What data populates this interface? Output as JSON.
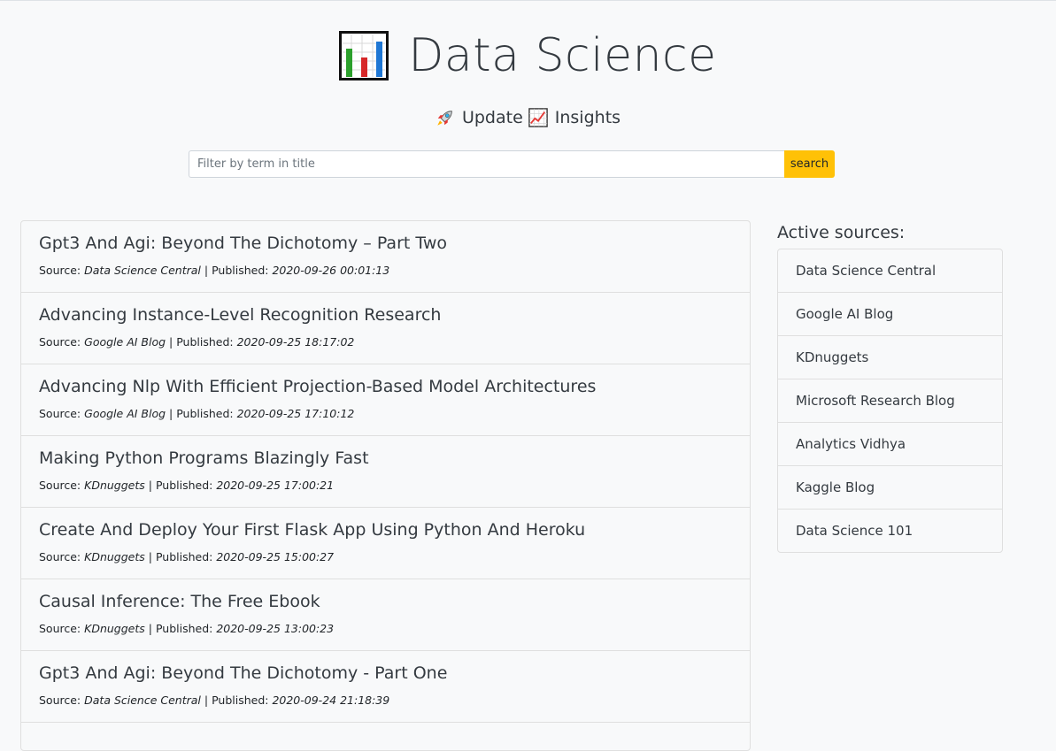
{
  "header": {
    "title": "Data Science",
    "logo_icon": "bar-chart-icon"
  },
  "nav": {
    "update_label": "Update",
    "update_icon": "rocket-icon",
    "insights_label": "Insights",
    "insights_icon": "chart-increasing-icon"
  },
  "search": {
    "placeholder": "Filter by term in title",
    "value": "",
    "button_label": "search",
    "button_color": "#ffc107"
  },
  "articles": [
    {
      "title": "Gpt3 And Agi: Beyond The Dichotomy – Part Two",
      "source_label": "Source:",
      "source": "Data Science Central",
      "published_label": "| Published:",
      "published": "2020-09-26 00:01:13"
    },
    {
      "title": "Advancing Instance-Level Recognition Research",
      "source_label": "Source:",
      "source": "Google AI Blog",
      "published_label": "| Published:",
      "published": "2020-09-25 18:17:02"
    },
    {
      "title": "Advancing Nlp With Efficient Projection-Based Model Architectures",
      "source_label": "Source:",
      "source": "Google AI Blog",
      "published_label": "| Published:",
      "published": "2020-09-25 17:10:12"
    },
    {
      "title": "Making Python Programs Blazingly Fast",
      "source_label": "Source:",
      "source": "KDnuggets",
      "published_label": "| Published:",
      "published": "2020-09-25 17:00:21"
    },
    {
      "title": "Create And Deploy Your First Flask App Using Python And Heroku",
      "source_label": "Source:",
      "source": "KDnuggets",
      "published_label": "| Published:",
      "published": "2020-09-25 15:00:27"
    },
    {
      "title": "Causal Inference: The Free Ebook",
      "source_label": "Source:",
      "source": "KDnuggets",
      "published_label": "| Published:",
      "published": "2020-09-25 13:00:23"
    },
    {
      "title": "Gpt3 And Agi: Beyond The Dichotomy - Part One",
      "source_label": "Source:",
      "source": "Data Science Central",
      "published_label": "| Published:",
      "published": "2020-09-24 21:18:39"
    }
  ],
  "sidebar": {
    "title": "Active sources:",
    "sources": [
      "Data Science Central",
      "Google AI Blog",
      "KDnuggets",
      "Microsoft Research Blog",
      "Analytics Vidhya",
      "Kaggle Blog",
      "Data Science 101"
    ]
  }
}
